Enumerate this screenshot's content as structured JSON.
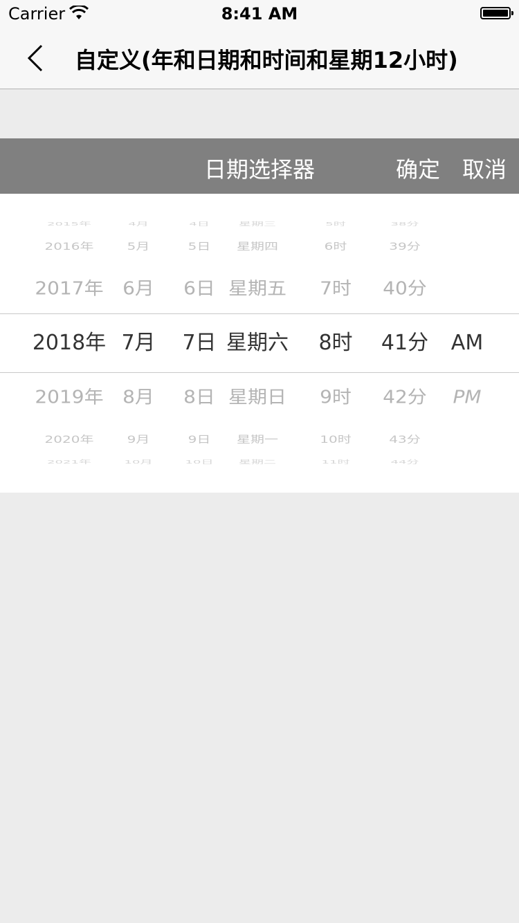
{
  "status_bar": {
    "carrier": "Carrier",
    "time": "8:41 AM"
  },
  "nav": {
    "title": "自定义(年和日期和时间和星期12小时)"
  },
  "picker": {
    "title": "日期选择器",
    "confirm_label": "确定",
    "cancel_label": "取消",
    "rows": [
      {
        "year": "2015年",
        "month": "4月",
        "day": "4日",
        "week": "星期三",
        "hour": "5时",
        "minute": "38分",
        "ampm": ""
      },
      {
        "year": "2016年",
        "month": "5月",
        "day": "5日",
        "week": "星期四",
        "hour": "6时",
        "minute": "39分",
        "ampm": ""
      },
      {
        "year": "2017年",
        "month": "6月",
        "day": "6日",
        "week": "星期五",
        "hour": "7时",
        "minute": "40分",
        "ampm": ""
      },
      {
        "year": "2018年",
        "month": "7月",
        "day": "7日",
        "week": "星期六",
        "hour": "8时",
        "minute": "41分",
        "ampm": "AM"
      },
      {
        "year": "2019年",
        "month": "8月",
        "day": "8日",
        "week": "星期日",
        "hour": "9时",
        "minute": "42分",
        "ampm": "PM"
      },
      {
        "year": "2020年",
        "month": "9月",
        "day": "9日",
        "week": "星期一",
        "hour": "10时",
        "minute": "43分",
        "ampm": ""
      },
      {
        "year": "2021年",
        "month": "10月",
        "day": "10日",
        "week": "星期二",
        "hour": "11时",
        "minute": "44分",
        "ampm": ""
      }
    ]
  },
  "colors": {
    "toolbar_bg": "#808080",
    "page_bg": "#ececec",
    "selected_text": "#333333"
  }
}
